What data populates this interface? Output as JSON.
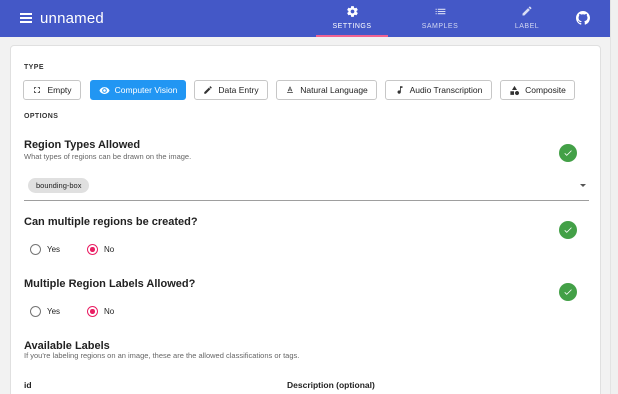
{
  "app": {
    "title": "unnamed",
    "nav_tabs": [
      {
        "label": "SETTINGS",
        "icon": "gear-icon"
      },
      {
        "label": "SAMPLES",
        "icon": "list-icon"
      },
      {
        "label": "LABEL",
        "icon": "pencil-icon"
      }
    ],
    "active_tab": "SETTINGS",
    "accent": "#4458c7"
  },
  "type_section": {
    "heading": "TYPE",
    "buttons": [
      {
        "label": "Empty",
        "icon": "fullscreen-icon"
      },
      {
        "label": "Computer Vision",
        "icon": "eye-icon"
      },
      {
        "label": "Data Entry",
        "icon": "pencil-icon"
      },
      {
        "label": "Natural Language",
        "icon": "text-format-icon"
      },
      {
        "label": "Audio Transcription",
        "icon": "music-note-icon"
      },
      {
        "label": "Composite",
        "icon": "category-icon"
      }
    ],
    "selected": "Computer Vision"
  },
  "options": {
    "heading": "OPTIONS",
    "region_types": {
      "title": "Region Types Allowed",
      "description": "What types of regions can be drawn on the image.",
      "selected": [
        "bounding-box"
      ]
    },
    "multiple_regions": {
      "title": "Can multiple regions be created?",
      "options": [
        "Yes",
        "No"
      ],
      "selected": "No"
    },
    "multiple_region_labels": {
      "title": "Multiple Region Labels Allowed?",
      "options": [
        "Yes",
        "No"
      ],
      "selected": "No"
    },
    "available_labels": {
      "title": "Available Labels",
      "description": "If you're labeling regions on an image, these are the allowed classifications or tags.",
      "columns": [
        "id",
        "Description (optional)"
      ]
    }
  },
  "colors": {
    "primary": "#2196f3",
    "success": "#43a047",
    "radio_selected": "#e91e63",
    "tab_indicator": "#f06292"
  }
}
